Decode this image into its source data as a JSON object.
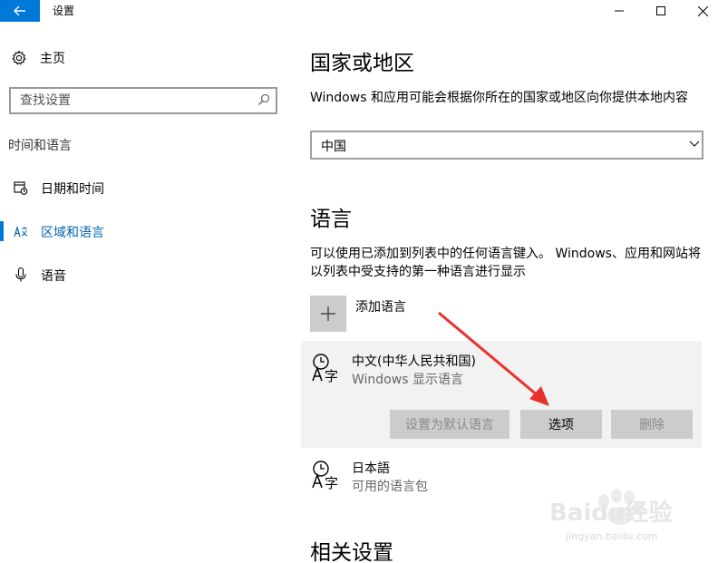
{
  "window": {
    "title": "设置"
  },
  "sidebar": {
    "home_label": "主页",
    "search_placeholder": "查找设置",
    "section_heading": "时间和语言",
    "items": [
      {
        "label": "日期和时间",
        "icon": "calendar-clock-icon",
        "active": false
      },
      {
        "label": "区域和语言",
        "icon": "region-language-icon",
        "active": true
      },
      {
        "label": "语音",
        "icon": "microphone-icon",
        "active": false
      }
    ]
  },
  "main": {
    "region": {
      "heading": "国家或地区",
      "description": "Windows 和应用可能会根据你所在的国家或地区向你提供本地内容",
      "selected": "中国"
    },
    "language": {
      "heading": "语言",
      "description": "可以使用已添加到列表中的任何语言键入。 Windows、应用和网站将以列表中受支持的第一种语言进行显示",
      "add_label": "添加语言",
      "languages": [
        {
          "name": "中文(中华人民共和国)",
          "sub": "Windows 显示语言",
          "selected": true
        },
        {
          "name": "日本語",
          "sub": "可用的语言包",
          "selected": false
        }
      ],
      "buttons": {
        "set_default": "设置为默认语言",
        "options": "选项",
        "remove": "删除"
      }
    },
    "related": {
      "heading": "相关设置"
    }
  },
  "watermark": {
    "brand": "Baidu经验",
    "url": "jingyan.baidu.com"
  },
  "colors": {
    "accent": "#0078d7",
    "arrow": "#e8312a",
    "button_bg": "#cccccc",
    "card_bg": "#f2f2f2"
  }
}
